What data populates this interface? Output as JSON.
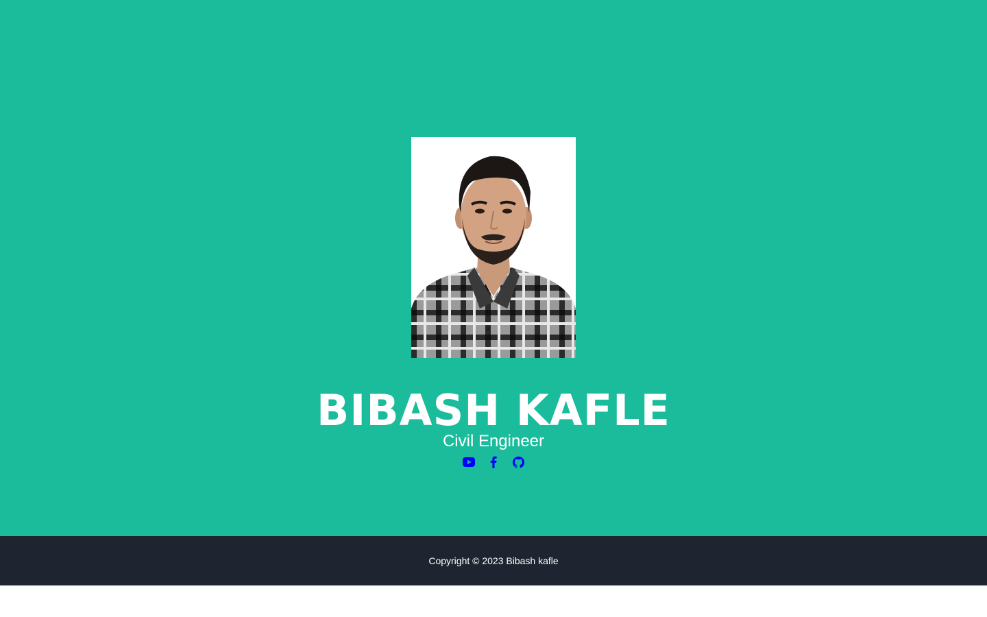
{
  "profile": {
    "name": "BIBASH KAFLE",
    "title": "Civil Engineer",
    "photo_alt": "profile-photo"
  },
  "socials": [
    {
      "icon": "youtube-icon"
    },
    {
      "icon": "facebook-icon"
    },
    {
      "icon": "github-icon"
    }
  ],
  "footer": {
    "copyright": "Copyright © 2023 Bibash kafle"
  },
  "colors": {
    "hero_background": "#1abc9c",
    "footer_background": "#1e2530",
    "icon_color": "#0000ff",
    "text_color": "#ffffff"
  }
}
